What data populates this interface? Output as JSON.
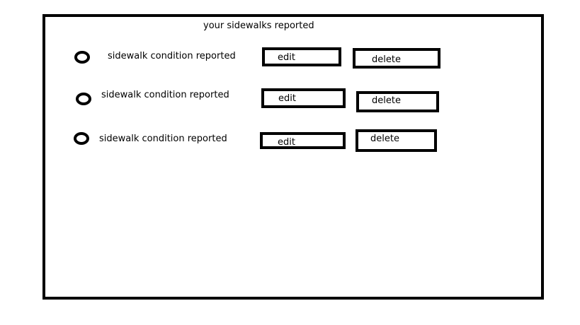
{
  "page": {
    "title": "your sidewalks reported"
  },
  "rows": [
    {
      "label": "sidewalk condition reported",
      "edit_label": "edit",
      "delete_label": "delete"
    },
    {
      "label": "sidewalk condition reported",
      "edit_label": "edit",
      "delete_label": "delete"
    },
    {
      "label": "sidewalk condition reported",
      "edit_label": "edit",
      "delete_label": "delete"
    }
  ],
  "colors": {
    "stroke": "#000000",
    "background": "#ffffff"
  }
}
